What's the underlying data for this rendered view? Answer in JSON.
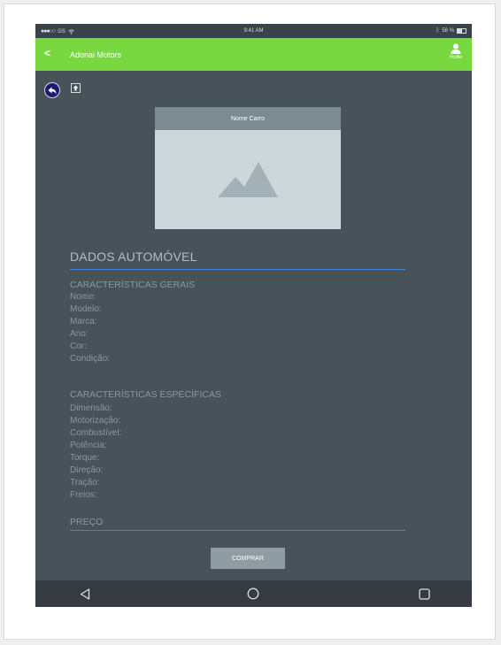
{
  "status_bar": {
    "carrier": "GS",
    "time": "9:41 AM",
    "battery": "58 %"
  },
  "app_bar": {
    "back_icon": "chevron-left-icon",
    "title": "Adonai Motors",
    "profile_label": "Profile",
    "profile_icon": "person-icon"
  },
  "toolbar": {
    "back_icon": "undo-arrow-icon",
    "upload_icon": "upload-icon"
  },
  "card": {
    "header": "Nome Carro",
    "image_icon": "image-placeholder-icon"
  },
  "details": {
    "title": "DADOS AUTOMÓVEL",
    "general_heading": "CARACTERÍSTICAS GERAIS",
    "general_fields": [
      "Nome:",
      "Modelo:",
      "Marca:",
      "Ano:",
      "Cor:",
      "Condição:"
    ],
    "specific_heading": "CARACTERÍSTICAS ESPECÍFICAS",
    "specific_fields": [
      "Dimensão:",
      "Motorização:",
      "Combustível:",
      "Potência:",
      "Torque:",
      "Direção:",
      "Tração:",
      "Freios:"
    ],
    "price_label": "PREÇO"
  },
  "buy_button": "COMPRAR",
  "nav_bar": {
    "back_icon": "triangle-back-icon",
    "home_icon": "circle-home-icon",
    "recent_icon": "square-recents-icon"
  },
  "colors": {
    "accent": "#79d83f",
    "background": "#475359",
    "underline": "#3f84d4"
  }
}
